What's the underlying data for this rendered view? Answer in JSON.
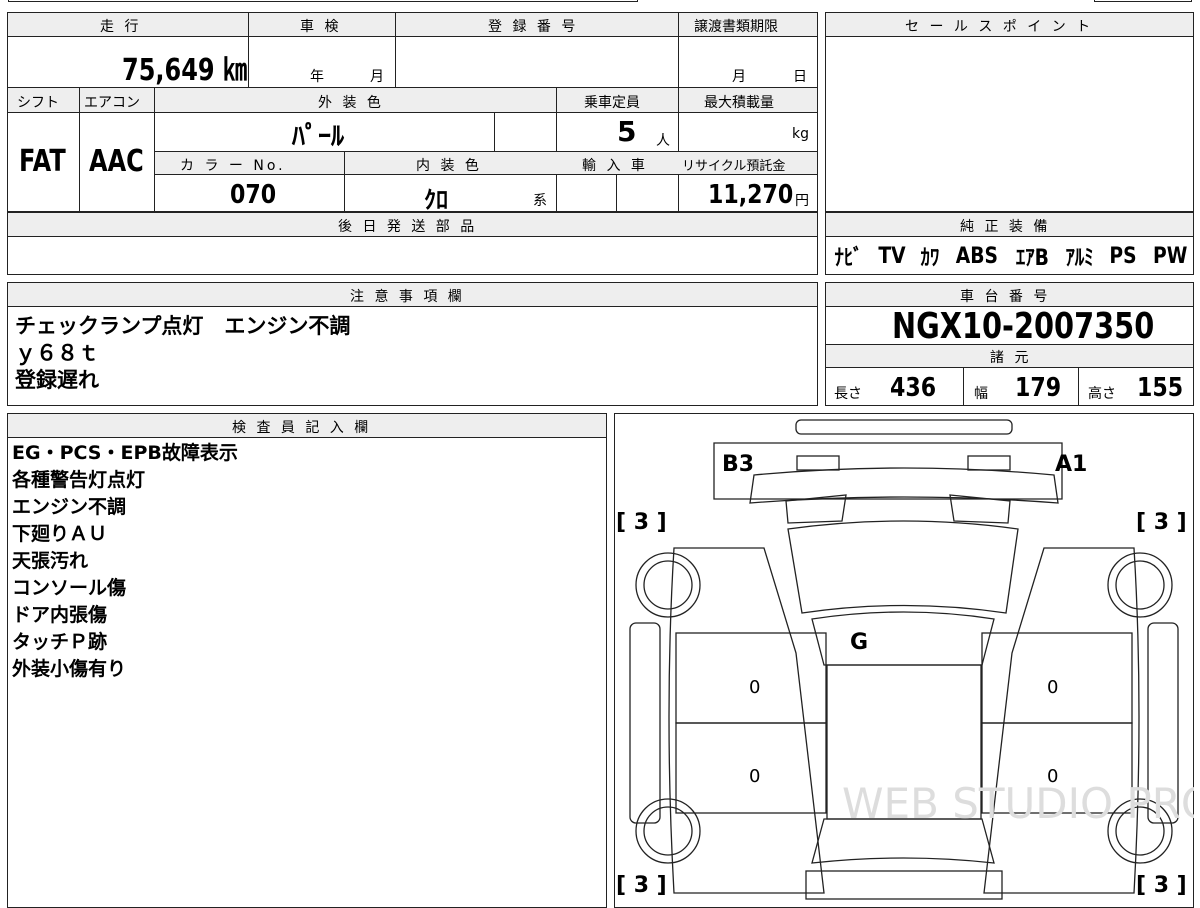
{
  "top_row": {
    "mileage_label": "走 行",
    "mileage_value": "75,649 ㎞",
    "shaken_label": "車 検",
    "shaken_year": "年",
    "shaken_month": "月",
    "reg_label": "登 録 番 号",
    "transfer_label": "譲渡書類期限",
    "transfer_month": "月",
    "transfer_day": "日",
    "sales_label": "セ ー ル ス ポ イ ン ト"
  },
  "second_row": {
    "shift_label": "シフト",
    "shift_value": "FAT",
    "ac_label": "エアコン",
    "ac_value": "AAC",
    "exterior_label": "外 装 色",
    "exterior_value": "ﾊﾟｰﾙ",
    "capacity_label": "乗車定員",
    "capacity_value": "5",
    "capacity_unit": "人",
    "maxload_label": "最大積載量",
    "maxload_unit": "kg",
    "color_no_label": "カ ラ ー No.",
    "color_no_value": "070",
    "interior_label": "内 装 色",
    "interior_value": "ｸﾛ",
    "interior_unit": "系",
    "import_label": "輸 入 車",
    "recycle_label": "リサイクル預託金",
    "recycle_value": "11,270",
    "recycle_unit": "円"
  },
  "later_parts_label": "後 日 発 送 部 品",
  "genuine_equipment_label": "純 正 装 備",
  "genuine_equipment": [
    "ﾅﾋﾞ",
    "TV",
    "ｶﾜ",
    "ABS",
    "ｴｱB",
    "ｱﾙﾐ",
    "PS",
    "PW"
  ],
  "notes_label": "注 意 事 項 欄",
  "notes": [
    "チェックランプ点灯　エンジン不調",
    "ｙ６８ｔ",
    "登録遅れ"
  ],
  "chassis_label": "車 台 番 号",
  "chassis_number": "NGX10-2007350",
  "specs_label": "諸 元",
  "specs": {
    "length_label": "長さ",
    "length_value": "436",
    "width_label": "幅",
    "width_value": "179",
    "height_label": "高さ",
    "height_value": "155"
  },
  "inspector_label": "検 査 員 記 入 欄",
  "inspector_notes": [
    "EG・PCS・EPB故障表示",
    "各種警告灯点灯",
    "エンジン不調",
    "下廻りＡＵ",
    "天張汚れ",
    "コンソール傷",
    "ドア内張傷",
    "タッチＰ跡",
    "外装小傷有り"
  ],
  "diagram": {
    "mark_b3": "B3",
    "mark_a1": "A1",
    "mark_g": "G",
    "tire_fl": "[ 3 ]",
    "tire_fr": "[ 3 ]",
    "tire_rl": "[ 3 ]",
    "tire_rr": "[ 3 ]",
    "door_fl": "0",
    "door_rl": "0",
    "door_fr": "0",
    "door_rr": "0",
    "watermark": "WEB STUDIO PRO"
  }
}
